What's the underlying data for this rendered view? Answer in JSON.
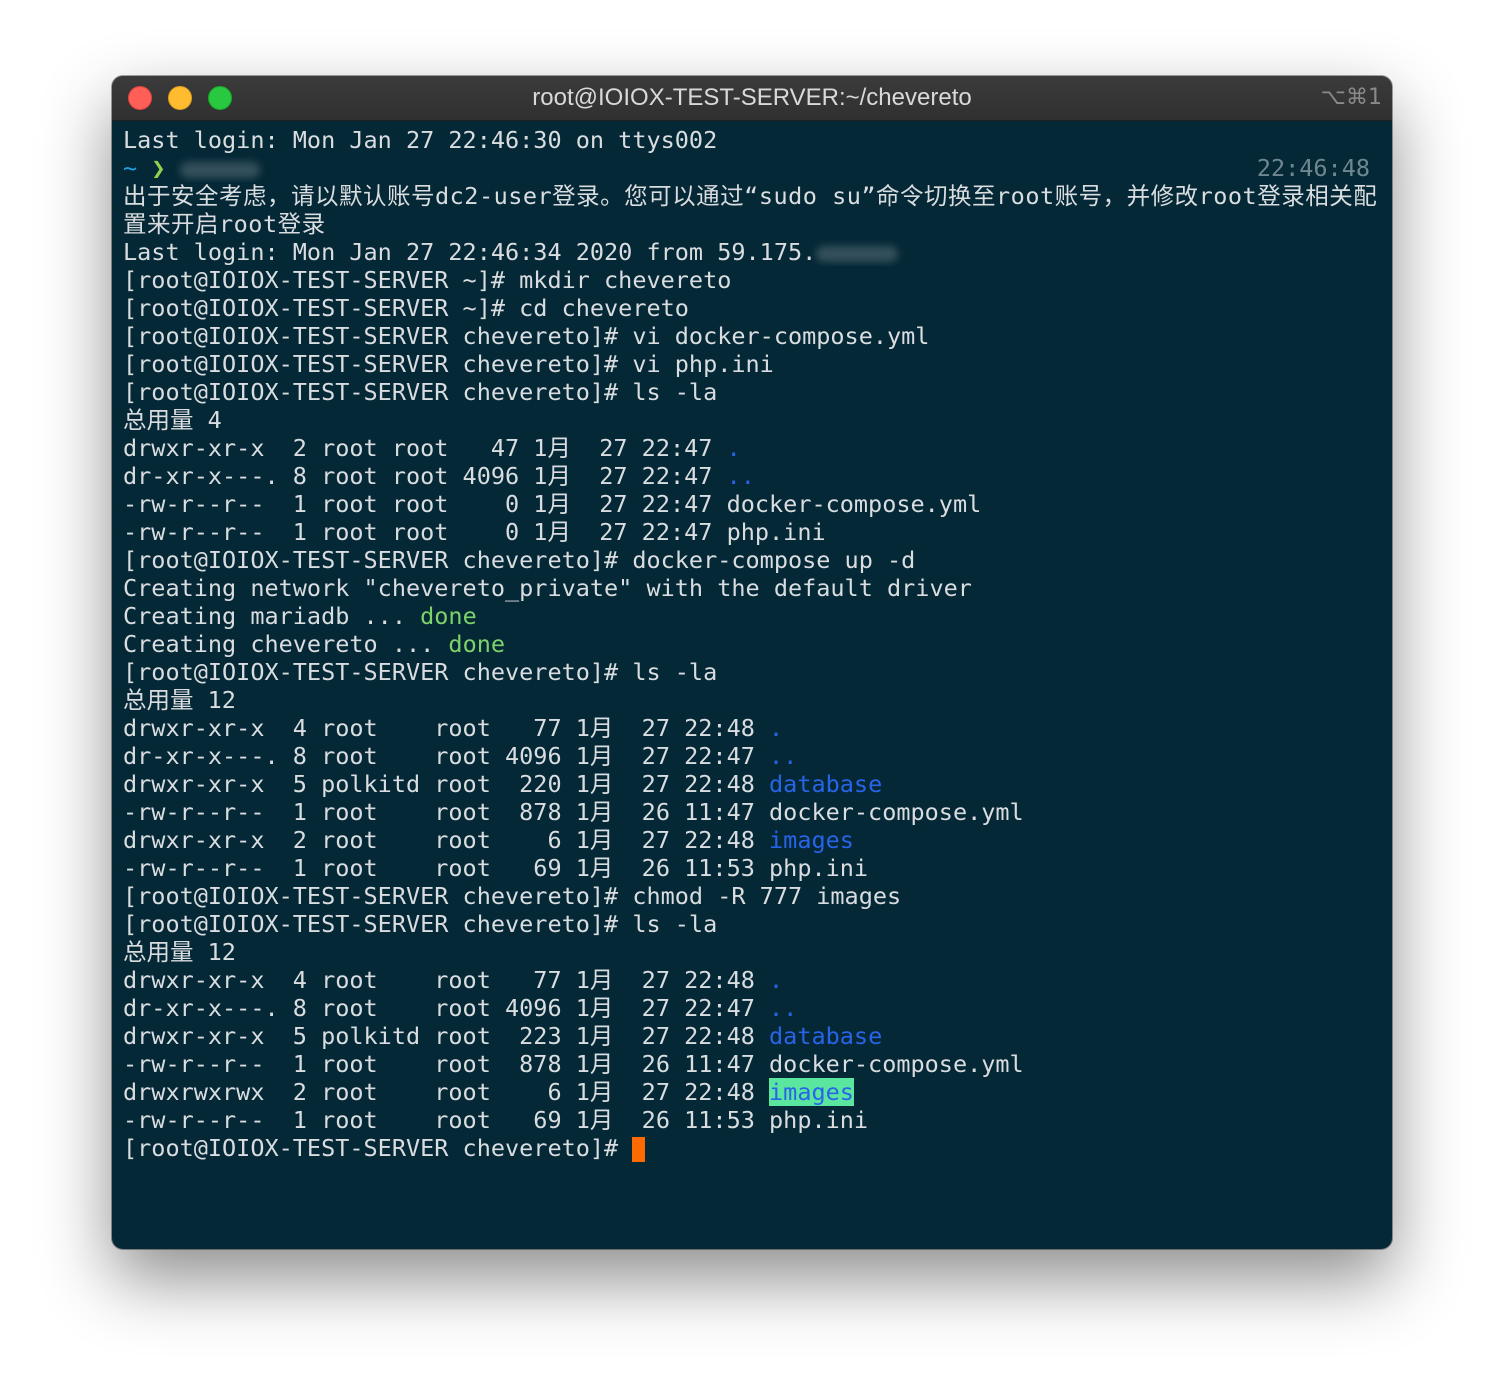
{
  "window": {
    "title": "root@IOIOX-TEST-SERVER:~/chevereto",
    "shortcut": "⌥⌘1"
  },
  "terminal": {
    "prompt_tilde": "~",
    "prompt_arrow": "❯",
    "prompt_time": "22:46:48",
    "prompt_cmd": "[root@IOIOX-TEST-SERVER chevereto]# ",
    "lines": [
      "Last login: Mon Jan 27 22:46:30 on ttys002",
      "出于安全考虑，请以默认账号dc2-user登录。您可以通过“sudo su”命令切换至root账号，并修改root登录相关配置来开启root登录",
      "Last login: Mon Jan 27 22:46:34 2020 from 59.175.",
      "[root@IOIOX-TEST-SERVER ~]# mkdir chevereto",
      "[root@IOIOX-TEST-SERVER ~]# cd chevereto",
      "[root@IOIOX-TEST-SERVER chevereto]# vi docker-compose.yml",
      "[root@IOIOX-TEST-SERVER chevereto]# vi php.ini",
      "[root@IOIOX-TEST-SERVER chevereto]# ls -la",
      "总用量 4",
      "drwxr-xr-x  2 root root   47 1月  27 22:47 ",
      ".",
      "dr-xr-x---. 8 root root 4096 1月  27 22:47 ",
      "..",
      "-rw-r--r--  1 root root    0 1月  27 22:47 docker-compose.yml",
      "-rw-r--r--  1 root root    0 1月  27 22:47 php.ini",
      "[root@IOIOX-TEST-SERVER chevereto]# docker-compose up -d",
      "Creating network \"chevereto_private\" with the default driver",
      "Creating mariadb ... ",
      "done",
      "Creating chevereto ... ",
      "done",
      "[root@IOIOX-TEST-SERVER chevereto]# ls -la",
      "总用量 12",
      "drwxr-xr-x  4 root    root   77 1月  27 22:48 ",
      ".",
      "dr-xr-x---. 8 root    root 4096 1月  27 22:47 ",
      "..",
      "drwxr-xr-x  5 polkitd root  220 1月  27 22:48 ",
      "database",
      "-rw-r--r--  1 root    root  878 1月  26 11:47 docker-compose.yml",
      "drwxr-xr-x  2 root    root    6 1月  27 22:48 ",
      "images",
      "-rw-r--r--  1 root    root   69 1月  26 11:53 php.ini",
      "[root@IOIOX-TEST-SERVER chevereto]# chmod -R 777 images",
      "[root@IOIOX-TEST-SERVER chevereto]# ls -la",
      "总用量 12",
      "drwxr-xr-x  4 root    root   77 1月  27 22:48 ",
      ".",
      "dr-xr-x---. 8 root    root 4096 1月  27 22:47 ",
      "..",
      "drwxr-xr-x  5 polkitd root  223 1月  27 22:48 ",
      "database",
      "-rw-r--r--  1 root    root  878 1月  26 11:47 docker-compose.yml",
      "drwxrwxrwx  2 root    root    6 1月  27 22:48 ",
      "images",
      "-rw-r--r--  1 root    root   69 1月  26 11:53 php.ini"
    ]
  },
  "colors": {
    "background": "#052836",
    "text": "#d9dde0",
    "directory": "#2864e8",
    "done": "#7dd36a",
    "world_writable_bg": "#5be6a0",
    "cursor": "#ff6a00"
  }
}
